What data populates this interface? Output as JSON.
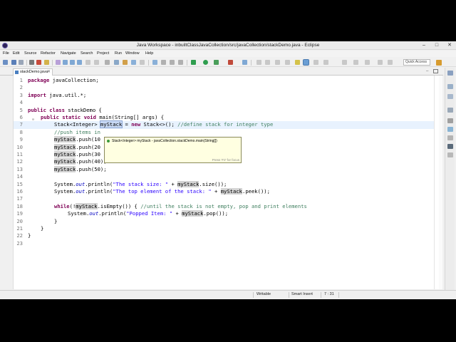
{
  "window": {
    "title": "Java Workspace - inbuiltClassJavaCollection/src/javaCollection/stackDemo.java - Eclipse"
  },
  "menu": [
    "File",
    "Edit",
    "Source",
    "Refactor",
    "Navigate",
    "Search",
    "Project",
    "Run",
    "Window",
    "Help"
  ],
  "toolbar": {
    "quick_access_placeholder": "Quick Access"
  },
  "editor_tab": {
    "label": "stackDemo.java",
    "close": "✕"
  },
  "code": {
    "l1": {
      "num": "1",
      "kw": "package",
      "rest": " javaCollection;"
    },
    "l2": {
      "num": "2"
    },
    "l3": {
      "num": "3",
      "kw": "import",
      "rest": " java.util.*;"
    },
    "l4": {
      "num": "4"
    },
    "l5": {
      "num": "5",
      "kw1": "public",
      "kw2": "class",
      "rest": " stackDemo {"
    },
    "l6": {
      "num": "6",
      "kw1": "public",
      "kw2": "static",
      "kw3": "void",
      "rest": " main(String[] args) {"
    },
    "l7": {
      "num": "7",
      "pre": "Stack<Integer> ",
      "var": "myStack",
      "mid": " = ",
      "kw": "new",
      "post": " Stack<>(); ",
      "cm": "//define stack for integer type"
    },
    "l8": {
      "num": "8",
      "cm": "//push items in"
    },
    "l9": {
      "num": "9",
      "var": "myStack",
      "rest": ".push(10"
    },
    "l10": {
      "num": "10",
      "var": "myStack",
      "rest": ".push(20"
    },
    "l11": {
      "num": "11",
      "var": "myStack",
      "rest": ".push(30"
    },
    "l12": {
      "num": "12",
      "var": "myStack",
      "rest": ".push(40);"
    },
    "l13": {
      "num": "13",
      "var": "myStack",
      "rest": ".push(50);"
    },
    "l14": {
      "num": "14"
    },
    "l15": {
      "num": "15",
      "pre": "System.",
      "out": "out",
      "mid": ".println(",
      "str": "\"The stack size: \"",
      "plus": " + ",
      "var": "myStack",
      "post": ".size());"
    },
    "l16": {
      "num": "16",
      "pre": "System.",
      "out": "out",
      "mid": ".println(",
      "str": "\"The top element of the stack: \"",
      "plus": " + ",
      "var": "myStack",
      "post": ".peek());"
    },
    "l17": {
      "num": "17"
    },
    "l18": {
      "num": "18",
      "kw": "while",
      "pre": "(!",
      "var": "myStack",
      "mid": ".isEmpty()) { ",
      "cm": "//until the stack is not empty, pop and print elements"
    },
    "l19": {
      "num": "19",
      "pre": "System.",
      "out": "out",
      "mid": ".println(",
      "str": "\"Popped Item: \"",
      "plus": " + ",
      "var": "myStack",
      "post": ".pop());"
    },
    "l20": {
      "num": "20",
      "rest": "}"
    },
    "l21": {
      "num": "21",
      "rest": "}"
    },
    "l22": {
      "num": "22",
      "rest": "}"
    },
    "l23": {
      "num": "23"
    }
  },
  "tooltip": {
    "text": "Stack<Integer> myStack - javaCollection.stackDemo.main(String[])",
    "hint": "Press 'F2' for focus"
  },
  "status": {
    "mode": "Writable",
    "insert": "Smart Insert",
    "position": "7 : 31"
  },
  "colors": {
    "keyword": "#7f0055",
    "comment": "#3f7f5f",
    "string": "#2a00ff",
    "current_line": "#e8f2fe",
    "tooltip_bg": "#ffffe1"
  }
}
